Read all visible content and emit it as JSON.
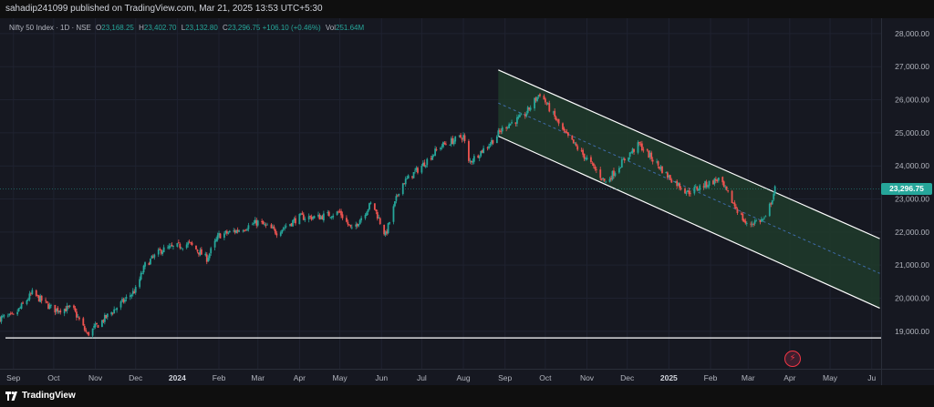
{
  "header": {
    "published": "sahadip241099 published on TradingView.com, Mar 21, 2025 13:53 UTC+5:30"
  },
  "legend": {
    "symbol": "Nifty 50 Index · 1D · NSE",
    "o_label": "O",
    "o_value": "23,168.25",
    "h_label": "H",
    "h_value": "23,402.70",
    "l_label": "L",
    "l_value": "23,132.80",
    "c_label": "C",
    "c_value": "23,296.75",
    "change": "+106.10 (+0.46%)",
    "vol_label": "Vol",
    "vol_value": "251.64M"
  },
  "last_price_label": "23,296.75",
  "footer": {
    "brand": "TradingView"
  },
  "colors": {
    "up": "#26a69a",
    "down": "#ef5350",
    "channel_fill": "#1f3b2a",
    "channel_border": "#ffffff",
    "midline": "#3e6aa8",
    "grid": "#1f2230"
  },
  "icons": [
    "tradingview-logo-icon",
    "lightning-event-icon"
  ],
  "chart_data": {
    "type": "candlestick",
    "title": "",
    "xlabel": "",
    "ylabel": "",
    "ylim": [
      18500,
      28300
    ],
    "y_ticks": [
      "28,000.00",
      "27,000.00",
      "26,000.00",
      "25,000.00",
      "24,000.00",
      "23,000.00",
      "22,000.00",
      "21,000.00",
      "20,000.00",
      "19,000.00"
    ],
    "y_tick_values": [
      28000,
      27000,
      26000,
      25000,
      24000,
      23000,
      22000,
      21000,
      20000,
      19000
    ],
    "x_ticks": [
      "Sep",
      "Oct",
      "Nov",
      "Dec",
      "2024",
      "Feb",
      "Mar",
      "Apr",
      "May",
      "Jun",
      "Jul",
      "Aug",
      "Sep",
      "Oct",
      "Nov",
      "Dec",
      "2025",
      "Feb",
      "Mar",
      "Apr",
      "May",
      "Ju"
    ],
    "x_tick_dates": [
      "2023-09-01",
      "2023-10-01",
      "2023-11-01",
      "2023-12-01",
      "2024-01-01",
      "2024-02-01",
      "2024-03-01",
      "2024-04-01",
      "2024-05-01",
      "2024-06-01",
      "2024-07-01",
      "2024-08-01",
      "2024-09-01",
      "2024-10-01",
      "2024-11-01",
      "2024-12-01",
      "2025-01-01",
      "2025-02-01",
      "2025-03-01",
      "2025-04-01",
      "2025-05-01",
      "2025-06-01"
    ],
    "x_range": [
      "2023-08-22",
      "2025-06-08"
    ],
    "series": [
      {
        "type": "close",
        "points": [
          [
            "2023-08-22",
            19400
          ],
          [
            "2023-09-01",
            19450
          ],
          [
            "2023-09-15",
            20150
          ],
          [
            "2023-10-01",
            19650
          ],
          [
            "2023-10-15",
            19700
          ],
          [
            "2023-10-26",
            18900
          ],
          [
            "2023-11-15",
            19650
          ],
          [
            "2023-12-01",
            20250
          ],
          [
            "2023-12-08",
            21000
          ],
          [
            "2023-12-20",
            21450
          ],
          [
            "2024-01-10",
            21650
          ],
          [
            "2024-01-23",
            21200
          ],
          [
            "2024-02-01",
            21900
          ],
          [
            "2024-02-15",
            22050
          ],
          [
            "2024-03-01",
            22300
          ],
          [
            "2024-03-15",
            22000
          ],
          [
            "2024-04-01",
            22450
          ],
          [
            "2024-04-15",
            22450
          ],
          [
            "2024-05-01",
            22600
          ],
          [
            "2024-05-10",
            22050
          ],
          [
            "2024-05-25",
            22900
          ],
          [
            "2024-06-04",
            21900
          ],
          [
            "2024-06-15",
            23400
          ],
          [
            "2024-07-01",
            24000
          ],
          [
            "2024-07-15",
            24600
          ],
          [
            "2024-08-01",
            24900
          ],
          [
            "2024-08-05",
            24100
          ],
          [
            "2024-08-20",
            24650
          ],
          [
            "2024-09-01",
            25200
          ],
          [
            "2024-09-15",
            25500
          ],
          [
            "2024-09-27",
            26200
          ],
          [
            "2024-10-15",
            25000
          ],
          [
            "2024-11-01",
            24200
          ],
          [
            "2024-11-15",
            23500
          ],
          [
            "2024-12-01",
            24300
          ],
          [
            "2024-12-10",
            24650
          ],
          [
            "2024-12-31",
            23700
          ],
          [
            "2025-01-15",
            23200
          ],
          [
            "2025-02-01",
            23500
          ],
          [
            "2025-02-07",
            23600
          ],
          [
            "2025-02-28",
            22200
          ],
          [
            "2025-03-05",
            22300
          ],
          [
            "2025-03-14",
            22400
          ],
          [
            "2025-03-21",
            23296.75
          ]
        ]
      }
    ],
    "annotations": [
      {
        "kind": "horizontal-line",
        "y": 18800
      },
      {
        "kind": "channel-upper",
        "from": [
          "2024-08-27",
          26900
        ],
        "to": [
          "2025-06-07",
          21800
        ]
      },
      {
        "kind": "channel-lower",
        "from": [
          "2024-08-27",
          24900
        ],
        "to": [
          "2025-06-07",
          19700
        ]
      },
      {
        "kind": "channel-mid",
        "from": [
          "2024-08-27",
          25900
        ],
        "to": [
          "2025-06-07",
          20750
        ]
      },
      {
        "kind": "last-price",
        "y": 23296.75
      }
    ],
    "grid": true,
    "legend": "top-left"
  }
}
